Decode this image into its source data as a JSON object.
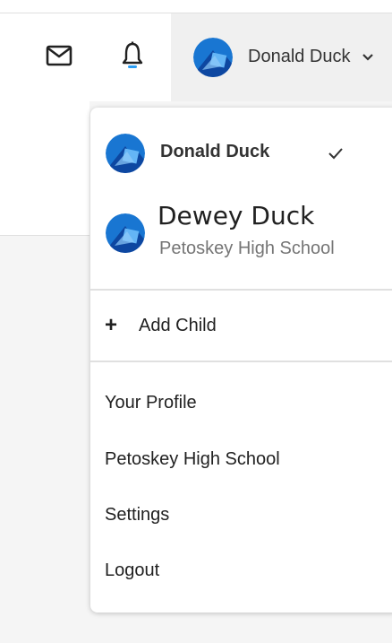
{
  "header": {
    "user_name": "Donald Duck",
    "icons": {
      "mail": "mail-icon",
      "bell": "bell-icon",
      "chevron": "chevron-down-icon"
    }
  },
  "dropdown": {
    "accounts": [
      {
        "name": "Donald Duck",
        "selected": true
      },
      {
        "name": "Dewey Duck",
        "school": "Petoskey High School",
        "selected": false
      }
    ],
    "add_child_label": "Add Child",
    "links": [
      "Your Profile",
      "Petoskey High School",
      "Settings",
      "Logout"
    ]
  },
  "colors": {
    "accent": "#2a9df4",
    "avatar_primary": "#1976d2",
    "avatar_dark": "#0d47a1",
    "chip_bg": "#f0f0f0",
    "page_bg": "#f5f5f5"
  }
}
